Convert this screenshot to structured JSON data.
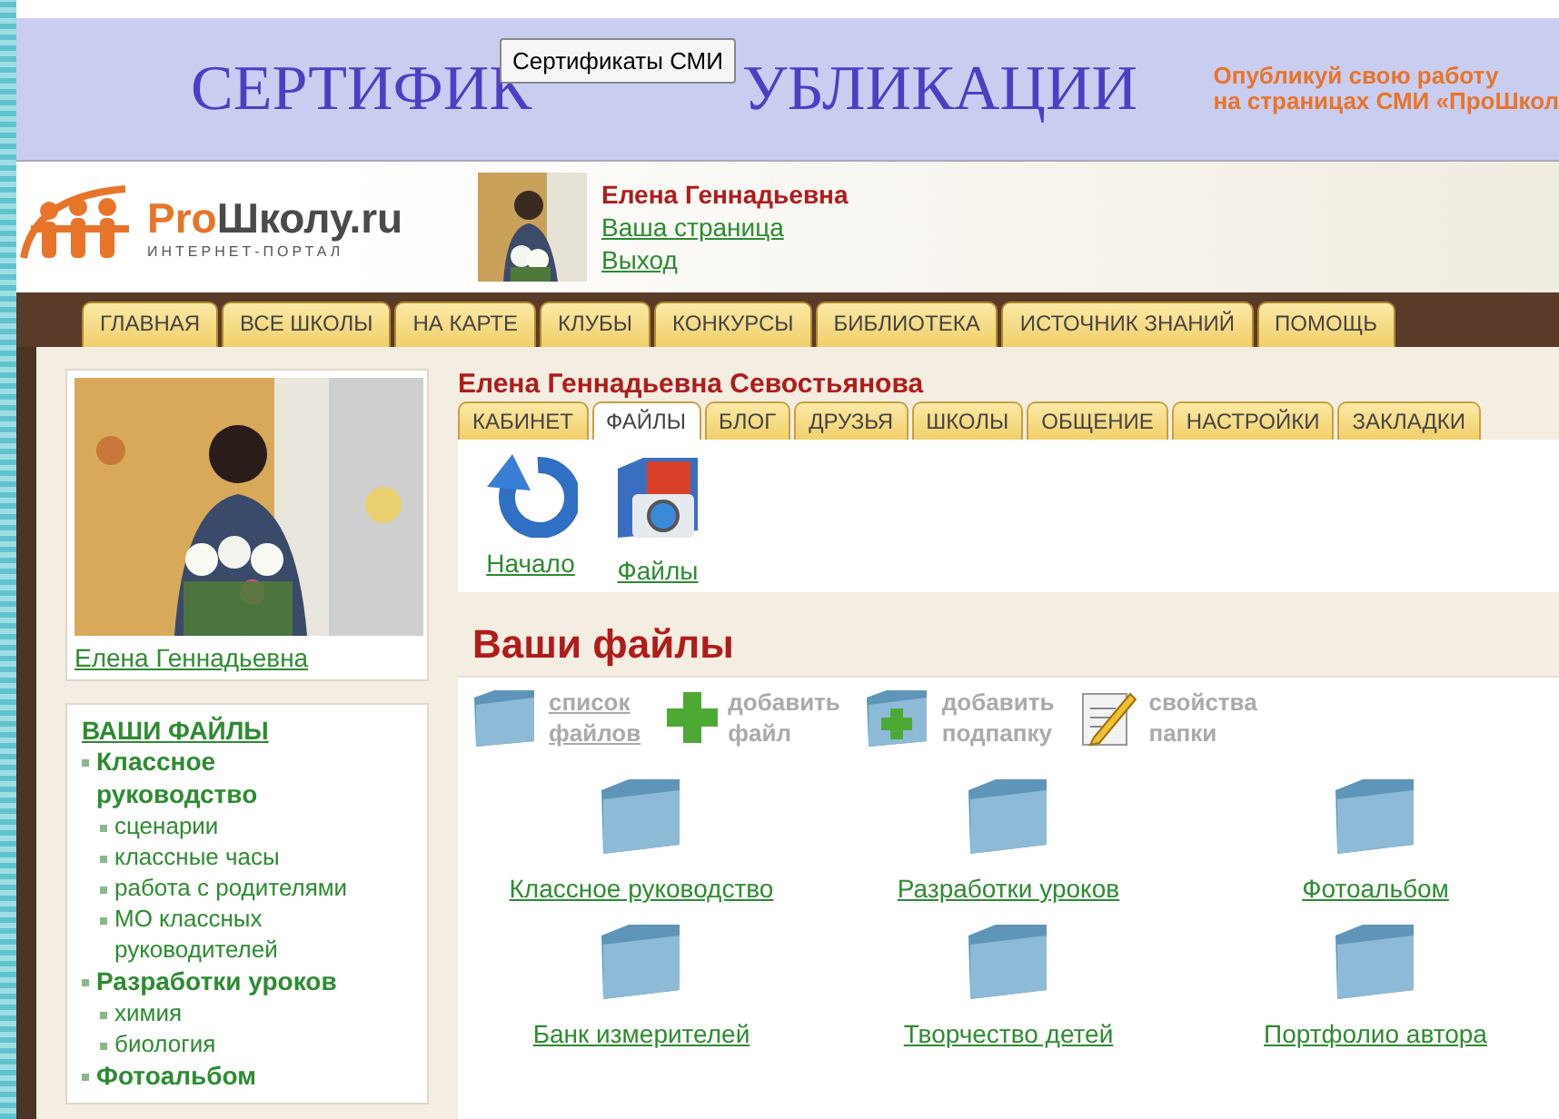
{
  "banner": {
    "title_left": "СЕРТИФИК",
    "title_right": "УБЛИКАЦИИ",
    "tooltip": "Сертификаты СМИ",
    "promo_lines": [
      "Опубликуй свою работу",
      "на страницах СМИ «ПроШкол"
    ]
  },
  "logo": {
    "brand_accent": "Pro",
    "brand_rest": "Школу.ru",
    "tagline": "ИНТЕРНЕТ-ПОРТАЛ"
  },
  "user": {
    "name": "Елена Геннадьевна",
    "links": [
      "Ваша страница",
      "Выход"
    ]
  },
  "nav_tabs": [
    "ГЛАВНАЯ",
    "ВСЕ ШКОЛЫ",
    "НА КАРТЕ",
    "КЛУБЫ",
    "КОНКУРСЫ",
    "БИБЛИОТЕКА",
    "ИСТОЧНИК ЗНАНИЙ",
    "ПОМОЩЬ"
  ],
  "profile_card": {
    "name_link": "Елена Геннадьевна"
  },
  "sidebar": {
    "heading": "ВАШИ ФАЙЛЫ",
    "items": [
      {
        "label": "Классное руководство",
        "children": [
          {
            "label": "сценарии"
          },
          {
            "label": "классные часы"
          },
          {
            "label": "работа с родителями"
          },
          {
            "label": "МО классных руководителей"
          }
        ]
      },
      {
        "label": "Разработки уроков",
        "children": [
          {
            "label": "химия"
          },
          {
            "label": "биология"
          }
        ]
      },
      {
        "label": "Фотоальбом"
      }
    ]
  },
  "profile": {
    "full_name": "Елена Геннадьевна Севостьянова",
    "tabs": [
      {
        "label": "КАБИНЕТ",
        "selected": false
      },
      {
        "label": "ФАЙЛЫ",
        "selected": true
      },
      {
        "label": "БЛОГ",
        "selected": false
      },
      {
        "label": "ДРУЗЬЯ",
        "selected": false
      },
      {
        "label": "ШКОЛЫ",
        "selected": false
      },
      {
        "label": "ОБЩЕНИЕ",
        "selected": false
      },
      {
        "label": "НАСТРОЙКИ",
        "selected": false
      },
      {
        "label": "ЗАКЛАДКИ",
        "selected": false
      }
    ],
    "quick_links": [
      {
        "kind": "home",
        "label": "Начало"
      },
      {
        "kind": "files",
        "label": "Файлы"
      }
    ]
  },
  "files": {
    "heading": "Ваши файлы",
    "toolbar": [
      {
        "kind": "folder",
        "lines": [
          "список",
          "файлов"
        ],
        "disabled": false
      },
      {
        "kind": "add",
        "lines": [
          "добавить",
          "файл"
        ],
        "disabled": true
      },
      {
        "kind": "add-folder",
        "lines": [
          "добавить",
          "подпапку"
        ],
        "disabled": true
      },
      {
        "kind": "properties",
        "lines": [
          "свойства",
          "папки"
        ],
        "disabled": true
      }
    ],
    "folders": [
      {
        "label": "Классное руководство"
      },
      {
        "label": "Разработки уроков"
      },
      {
        "label": "Фотоальбом"
      },
      {
        "label": "Банк измерителей"
      },
      {
        "label": "Творчество детей"
      },
      {
        "label": "Портфолио автора"
      }
    ]
  }
}
